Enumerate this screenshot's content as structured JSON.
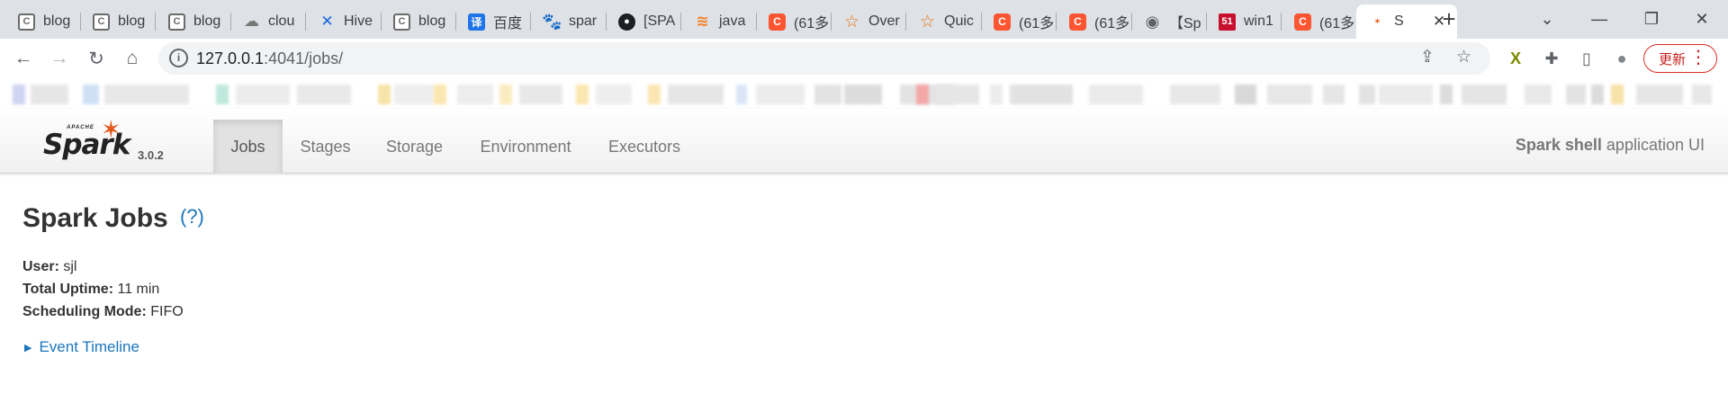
{
  "browser": {
    "tabs": [
      {
        "label": "blog",
        "icon": "blank-doc-icon",
        "glyph": "C"
      },
      {
        "label": "blog",
        "icon": "blank-doc-icon",
        "glyph": "C"
      },
      {
        "label": "blog",
        "icon": "blank-doc-icon",
        "glyph": "C"
      },
      {
        "label": "clou",
        "icon": "cloud-icon",
        "glyph": "☁"
      },
      {
        "label": "Hive",
        "icon": "confluence-icon",
        "glyph": "✕"
      },
      {
        "label": "blog",
        "icon": "blank-doc-icon",
        "glyph": "C"
      },
      {
        "label": "百度",
        "icon": "translate-icon",
        "glyph": "译"
      },
      {
        "label": "spar",
        "icon": "baidu-paw-icon",
        "glyph": "🐾"
      },
      {
        "label": "[SPA",
        "icon": "github-icon",
        "glyph": "●"
      },
      {
        "label": "java",
        "icon": "stackoverflow-icon",
        "glyph": "≋"
      },
      {
        "label": "(61多",
        "icon": "csdn-icon",
        "glyph": "C"
      },
      {
        "label": "Over",
        "icon": "star-icon",
        "glyph": "☆"
      },
      {
        "label": "Quic",
        "icon": "star-icon",
        "glyph": "☆"
      },
      {
        "label": "(61多",
        "icon": "csdn-icon",
        "glyph": "C"
      },
      {
        "label": "(61多",
        "icon": "csdn-icon",
        "glyph": "C"
      },
      {
        "label": "【Sp",
        "icon": "globe-icon",
        "glyph": "◉"
      },
      {
        "label": "win1",
        "icon": "fifty-one-icon",
        "glyph": "51"
      },
      {
        "label": "(61多",
        "icon": "csdn-icon",
        "glyph": "C"
      },
      {
        "label": "S",
        "icon": "spark-favicon-icon",
        "glyph": "✶",
        "active": true
      }
    ],
    "new_tab_glyph": "+",
    "tab_close_glyph": "✕",
    "tab_search_glyph": "⌄",
    "window_controls": {
      "minimize": "—",
      "restore": "❐",
      "close": "✕"
    },
    "url_host": "127.0.0.1",
    "url_rest": ":4041/jobs/",
    "info_glyph": "i",
    "update_label": "更新",
    "update_menu_glyph": "⋮",
    "nav_glyphs": {
      "back": "←",
      "forward": "→",
      "reload": "↻",
      "home": "⌂",
      "share": "⇪",
      "bookmark": "☆"
    },
    "extension_glyphs": {
      "ext1": "X",
      "puzzle": "✚",
      "sidepanel": "▯",
      "profile": "●"
    }
  },
  "spark": {
    "logo_apache": "APACHE",
    "logo_word": "Spark",
    "logo_star": "✶",
    "version": "3.0.2",
    "nav": [
      {
        "label": "Jobs",
        "active": true
      },
      {
        "label": "Stages"
      },
      {
        "label": "Storage"
      },
      {
        "label": "Environment"
      },
      {
        "label": "Executors"
      }
    ],
    "app_name_bold": "Spark shell",
    "app_name_rest": " application UI"
  },
  "page": {
    "title": "Spark Jobs",
    "help": "(?)",
    "summary": [
      {
        "label": "User:",
        "value": " sjl"
      },
      {
        "label": "Total Uptime:",
        "value": " 11 min"
      },
      {
        "label": "Scheduling Mode:",
        "value": " FIFO"
      }
    ],
    "timeline_arrow": "▶",
    "timeline_label": "Event Timeline"
  }
}
